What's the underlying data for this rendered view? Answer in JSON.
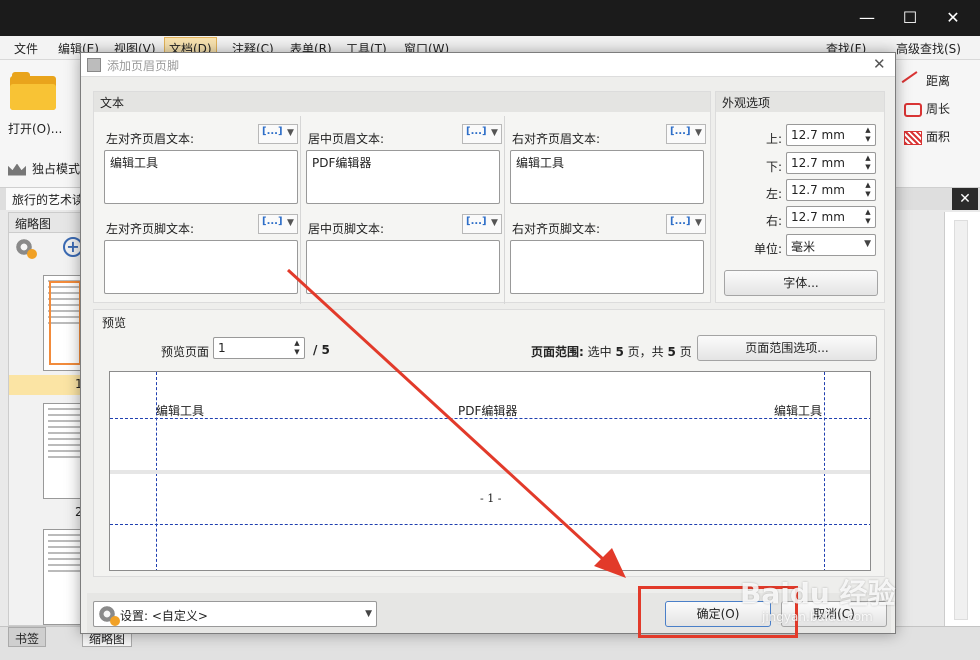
{
  "window": {
    "controls": {
      "minimize": "—",
      "maximize": "☐",
      "close": "✕"
    }
  },
  "menubar": {
    "items": [
      "文件",
      "编辑(E)",
      "视图(V)",
      "文档(D)",
      "注释(C)",
      "表单(R)",
      "工具(T)",
      "窗口(W)"
    ],
    "right_tools": [
      "查找(F)",
      "高级查找(S)"
    ]
  },
  "ribbon": {
    "open_label": "打开(O)...",
    "solo_mode": "独占模式",
    "measure_tools": [
      "距离",
      "周长",
      "面积"
    ]
  },
  "doc_tab": {
    "title": "旅行的艺术读"
  },
  "thumbnails": {
    "panel_title": "缩略图",
    "pages": [
      "1",
      "2"
    ]
  },
  "bottom_tabs": [
    "书签",
    "缩略图"
  ],
  "dialog": {
    "title": "添加页眉页脚",
    "close": "✕",
    "text_group": {
      "title": "文本",
      "macro_glyph": "[...]",
      "header_left_label": "左对齐页眉文本:",
      "header_center_label": "居中页眉文本:",
      "header_right_label": "右对齐页眉文本:",
      "header_left_value": "编辑工具",
      "header_center_value": "PDF编辑器",
      "header_right_value": "编辑工具",
      "footer_left_label": "左对齐页脚文本:",
      "footer_center_label": "居中页脚文本:",
      "footer_right_label": "右对齐页脚文本:",
      "footer_left_value": "",
      "footer_center_value": "",
      "footer_right_value": ""
    },
    "appearance": {
      "title": "外观选项",
      "top_label": "上:",
      "top_value": "12.7 mm",
      "bottom_label": "下:",
      "bottom_value": "12.7 mm",
      "left_label": "左:",
      "left_value": "12.7 mm",
      "right_label": "右:",
      "right_value": "12.7 mm",
      "unit_label": "单位:",
      "unit_value": "毫米",
      "font_button": "字体..."
    },
    "preview": {
      "title": "预览",
      "page_label": "预览页面",
      "page_value": "1",
      "page_total": "/ 5",
      "range_label": "页面范围:",
      "range_pre": "选中",
      "range_selected": "5",
      "range_mid": "页，共",
      "range_total": "5",
      "range_post": "页",
      "range_button": "页面范围选项...",
      "header_left": "编辑工具",
      "header_center": "PDF编辑器",
      "header_right": "编辑工具",
      "footer_page": "- 1 -"
    },
    "settings": {
      "label": "设置:",
      "value": "<自定义>"
    },
    "ok_button": "确定(O)",
    "cancel_button": "取消(C)"
  },
  "watermark": {
    "text": "Baidu 经验",
    "sub": "jingyan.baidu.com"
  },
  "colors": {
    "annotation_red": "#e23a2a",
    "guide_blue": "#1f3fb0"
  }
}
